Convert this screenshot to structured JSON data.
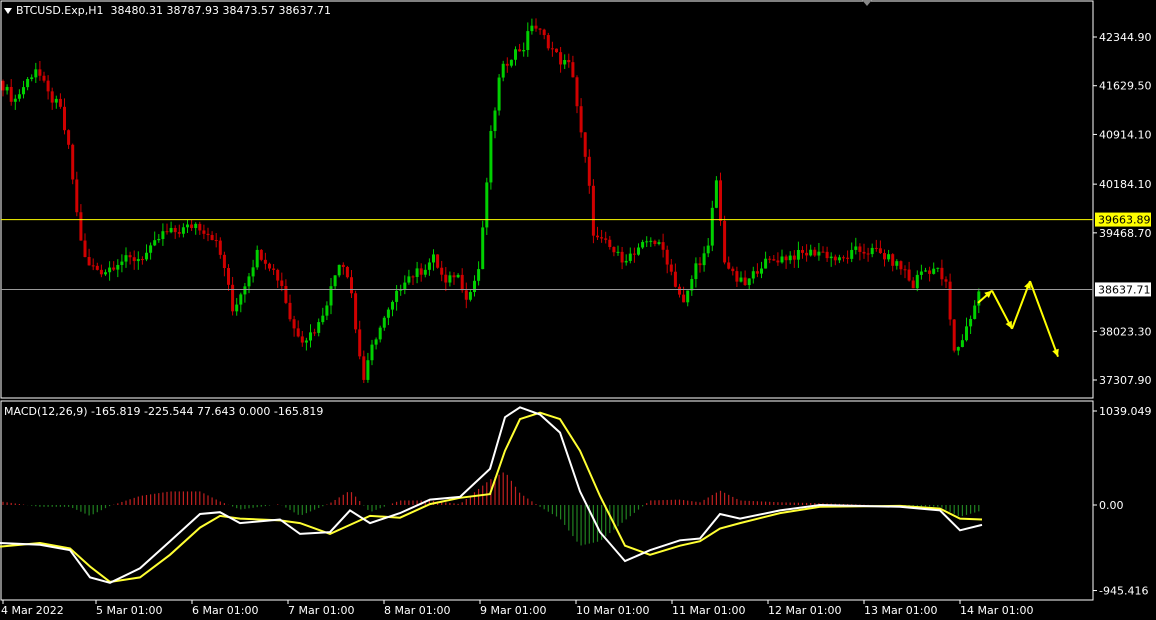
{
  "header": {
    "symbol": "BTCUSD.Exp,H1",
    "ohlc": "38480.31 38787.93 38473.57 38637.71"
  },
  "macd_header": {
    "text": "MACD(12,26,9) -165.819 -225.544 77.643 0.000 -165.819"
  },
  "colors": {
    "background": "#000000",
    "bull": "#00d000",
    "bear": "#d00000",
    "support_line": "#ffff00",
    "current_line": "#9a9a9a",
    "signal": "#ffff33",
    "macd_line": "#ffffff",
    "projection": "#ffff00"
  },
  "chart_data": [
    {
      "type": "candlestick",
      "title": "BTCUSD.Exp,H1",
      "y_ticks": [
        42344.9,
        41629.5,
        40914.1,
        40184.1,
        39468.7,
        38023.3,
        37307.9
      ],
      "y_tick_labels": [
        "42344.90",
        "41629.50",
        "40914.10",
        "40184.10",
        "39468.70",
        "38023.30",
        "37307.90"
      ],
      "ylim": [
        37150,
        42780
      ],
      "x_labels": [
        "4 Mar 2022",
        "5 Mar 01:00",
        "6 Mar 01:00",
        "7 Mar 01:00",
        "8 Mar 01:00",
        "9 Mar 01:00",
        "10 Mar 01:00",
        "11 Mar 01:00",
        "12 Mar 01:00",
        "13 Mar 01:00",
        "14 Mar 01:00"
      ],
      "close_path": [
        [
          0,
          41700
        ],
        [
          14,
          41400
        ],
        [
          36,
          41900
        ],
        [
          48,
          41500
        ],
        [
          60,
          41300
        ],
        [
          70,
          40600
        ],
        [
          78,
          39600
        ],
        [
          86,
          39000
        ],
        [
          104,
          38900
        ],
        [
          118,
          39050
        ],
        [
          140,
          39100
        ],
        [
          150,
          39200
        ],
        [
          162,
          39450
        ],
        [
          180,
          39500
        ],
        [
          196,
          39600
        ],
        [
          214,
          39400
        ],
        [
          226,
          38900
        ],
        [
          232,
          38300
        ],
        [
          244,
          38700
        ],
        [
          258,
          39200
        ],
        [
          270,
          39000
        ],
        [
          282,
          38700
        ],
        [
          292,
          38100
        ],
        [
          304,
          37900
        ],
        [
          318,
          38100
        ],
        [
          330,
          38600
        ],
        [
          340,
          39100
        ],
        [
          350,
          38800
        ],
        [
          356,
          38000
        ],
        [
          364,
          37300
        ],
        [
          374,
          37900
        ],
        [
          392,
          38400
        ],
        [
          404,
          38800
        ],
        [
          420,
          38900
        ],
        [
          434,
          39100
        ],
        [
          446,
          38700
        ],
        [
          456,
          38900
        ],
        [
          468,
          38500
        ],
        [
          480,
          39000
        ],
        [
          490,
          40800
        ],
        [
          500,
          41800
        ],
        [
          512,
          42100
        ],
        [
          524,
          42200
        ],
        [
          532,
          42550
        ],
        [
          546,
          42300
        ],
        [
          560,
          42000
        ],
        [
          572,
          41900
        ],
        [
          580,
          41000
        ],
        [
          588,
          40300
        ],
        [
          594,
          39400
        ],
        [
          606,
          39300
        ],
        [
          620,
          39100
        ],
        [
          636,
          39150
        ],
        [
          650,
          39400
        ],
        [
          664,
          39200
        ],
        [
          676,
          38700
        ],
        [
          684,
          38400
        ],
        [
          696,
          39000
        ],
        [
          708,
          39200
        ],
        [
          716,
          40300
        ],
        [
          724,
          39100
        ],
        [
          734,
          38800
        ],
        [
          746,
          38700
        ],
        [
          760,
          39000
        ],
        [
          780,
          39100
        ],
        [
          800,
          39150
        ],
        [
          820,
          39200
        ],
        [
          840,
          39050
        ],
        [
          856,
          39200
        ],
        [
          876,
          39200
        ],
        [
          892,
          39050
        ],
        [
          906,
          38900
        ],
        [
          912,
          38650
        ],
        [
          920,
          38900
        ],
        [
          936,
          38950
        ],
        [
          946,
          38700
        ],
        [
          954,
          37700
        ],
        [
          962,
          37900
        ],
        [
          972,
          38300
        ],
        [
          980,
          38640
        ]
      ],
      "horizontal_lines": [
        {
          "value": 39663.89,
          "label": "39663.89",
          "color": "#ffff00"
        },
        {
          "value": 38637.71,
          "label": "38637.71",
          "color": "#9a9a9a"
        }
      ],
      "projection_path": [
        [
          978,
          38440
        ],
        [
          992,
          38620
        ],
        [
          1012,
          38060
        ],
        [
          1030,
          38760
        ],
        [
          1058,
          37650
        ]
      ]
    },
    {
      "type": "macd",
      "title": "MACD(12,26,9)",
      "params": [
        12,
        26,
        9
      ],
      "values": {
        "macd": -165.819,
        "signal": -225.544,
        "histogram": 77.643
      },
      "y_tick_labels": [
        "1039.049",
        "0.00",
        "-945.416"
      ],
      "ylim": [
        -1100,
        1150
      ],
      "macd_path": [
        [
          0,
          -420
        ],
        [
          40,
          -440
        ],
        [
          70,
          -500
        ],
        [
          90,
          -800
        ],
        [
          110,
          -860
        ],
        [
          140,
          -700
        ],
        [
          170,
          -400
        ],
        [
          200,
          -100
        ],
        [
          220,
          -80
        ],
        [
          240,
          -200
        ],
        [
          280,
          -160
        ],
        [
          300,
          -320
        ],
        [
          330,
          -300
        ],
        [
          350,
          -60
        ],
        [
          370,
          -200
        ],
        [
          400,
          -90
        ],
        [
          430,
          60
        ],
        [
          460,
          90
        ],
        [
          490,
          400
        ],
        [
          505,
          970
        ],
        [
          520,
          1080
        ],
        [
          540,
          1000
        ],
        [
          560,
          800
        ],
        [
          580,
          150
        ],
        [
          600,
          -300
        ],
        [
          625,
          -620
        ],
        [
          650,
          -500
        ],
        [
          680,
          -390
        ],
        [
          700,
          -370
        ],
        [
          720,
          -100
        ],
        [
          740,
          -150
        ],
        [
          780,
          -60
        ],
        [
          820,
          0
        ],
        [
          900,
          -20
        ],
        [
          940,
          -60
        ],
        [
          960,
          -280
        ],
        [
          982,
          -220
        ]
      ],
      "signal_path": [
        [
          0,
          -460
        ],
        [
          40,
          -420
        ],
        [
          70,
          -480
        ],
        [
          90,
          -680
        ],
        [
          110,
          -850
        ],
        [
          140,
          -800
        ],
        [
          170,
          -550
        ],
        [
          200,
          -250
        ],
        [
          220,
          -120
        ],
        [
          240,
          -150
        ],
        [
          280,
          -170
        ],
        [
          300,
          -200
        ],
        [
          330,
          -320
        ],
        [
          350,
          -220
        ],
        [
          370,
          -120
        ],
        [
          400,
          -140
        ],
        [
          430,
          10
        ],
        [
          460,
          80
        ],
        [
          490,
          120
        ],
        [
          505,
          600
        ],
        [
          520,
          950
        ],
        [
          540,
          1020
        ],
        [
          560,
          950
        ],
        [
          580,
          600
        ],
        [
          600,
          100
        ],
        [
          625,
          -450
        ],
        [
          650,
          -550
        ],
        [
          680,
          -450
        ],
        [
          700,
          -400
        ],
        [
          720,
          -260
        ],
        [
          740,
          -200
        ],
        [
          780,
          -90
        ],
        [
          820,
          -20
        ],
        [
          900,
          -10
        ],
        [
          940,
          -40
        ],
        [
          960,
          -150
        ],
        [
          982,
          -160
        ]
      ]
    }
  ]
}
